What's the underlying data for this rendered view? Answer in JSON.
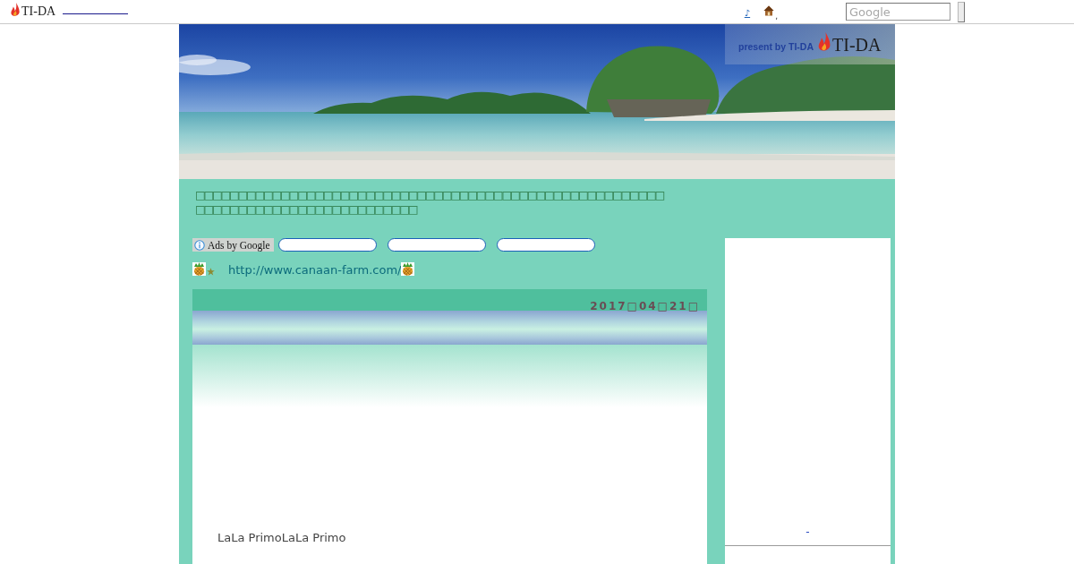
{
  "top_bar": {
    "logo_text": "TI-DA",
    "music_link": "♪",
    "separator": ",",
    "search": {
      "placeholder": "Google"
    }
  },
  "header": {
    "tagline": "present by TI-DA",
    "logo_text": "TI-DA"
  },
  "description": "□□□□□□□□□□□□□□□□□□□□□□□□□□□□□□□□□□□□□□□□□□□□□□□□□□□□□□□□□□□□□□□□□□□□□□□□□□□□□□□□□",
  "ads": {
    "label": "Ads by Google",
    "links": [
      {
        "kind": "pill"
      },
      {
        "kind": "pill"
      },
      {
        "kind": "pill"
      }
    ]
  },
  "site_link": {
    "url": "http://www.canaan-farm.com/"
  },
  "post": {
    "date": "2017□04□21□",
    "body": "LaLa PrimoLaLa Primo"
  },
  "sidebar": {
    "links": [
      "-"
    ]
  }
}
